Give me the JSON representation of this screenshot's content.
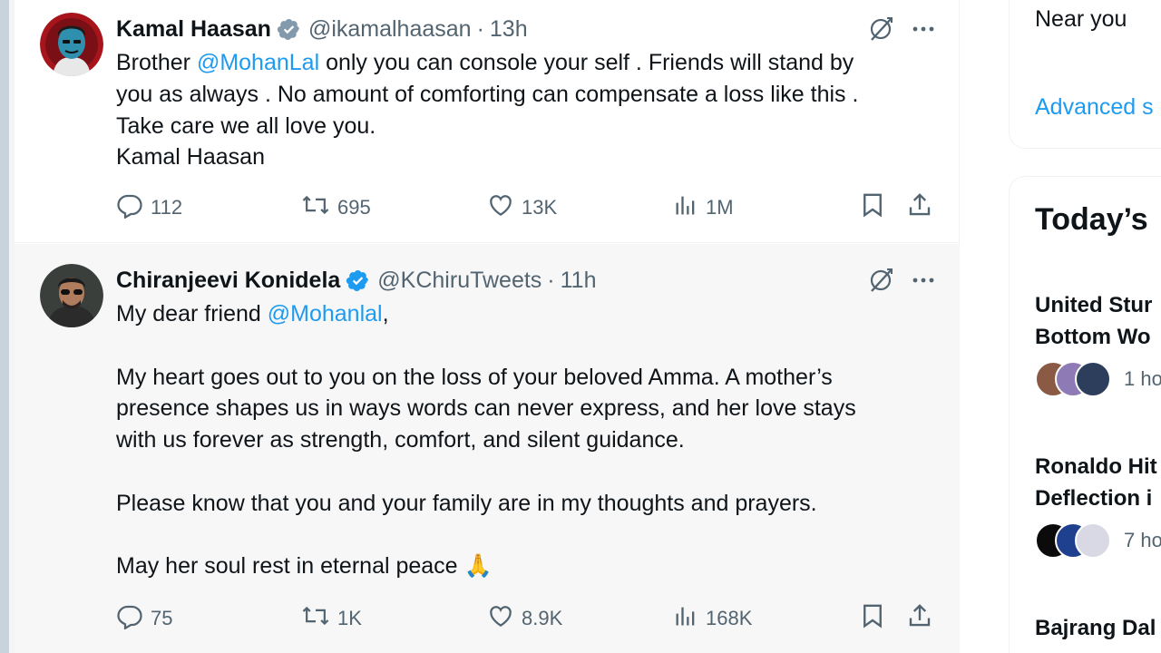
{
  "tweets": [
    {
      "name": "Kamal Haasan",
      "handle": "@ikamalhaasan",
      "separator": "·",
      "time": "13h",
      "paragraphs": [
        {
          "before": "Brother ",
          "mention": "@MohanLal",
          "after": " only you can console your self . Friends will stand by"
        },
        {
          "before": "you as always . No amount of comforting can compensate a loss like this .",
          "mention": "",
          "after": ""
        },
        {
          "before": "Take care we all love you.",
          "mention": "",
          "after": ""
        },
        {
          "before": "Kamal Haasan",
          "mention": "",
          "after": ""
        }
      ],
      "stats": {
        "replies": "112",
        "reposts": "695",
        "likes": "13K",
        "views": "1M"
      }
    },
    {
      "name": "Chiranjeevi Konidela",
      "handle": "@KChiruTweets",
      "separator": "·",
      "time": "11h",
      "paragraphs": [
        {
          "before": "My dear friend ",
          "mention": "@Mohanlal",
          "after": ","
        },
        {
          "before": "",
          "mention": "",
          "after": ""
        },
        {
          "before": "My heart goes out to you on the loss of your beloved Amma. A mother’s",
          "mention": "",
          "after": ""
        },
        {
          "before": "presence shapes us in ways words can never express, and her love stays",
          "mention": "",
          "after": ""
        },
        {
          "before": "with us forever as strength, comfort, and silent guidance.",
          "mention": "",
          "after": ""
        },
        {
          "before": "",
          "mention": "",
          "after": ""
        },
        {
          "before": "Please know that you and your family are in my thoughts and prayers.",
          "mention": "",
          "after": ""
        },
        {
          "before": "",
          "mention": "",
          "after": ""
        },
        {
          "before": "May her soul rest in eternal peace ",
          "mention": "",
          "after": "🙏"
        }
      ],
      "stats": {
        "replies": "75",
        "reposts": "1K",
        "likes": "8.9K",
        "views": "168K"
      }
    }
  ],
  "sidebar": {
    "location_label": "Near you",
    "advanced_search_label": "Advanced s",
    "trends_title": "Today’s",
    "trends": [
      {
        "title_line1": "United Stur",
        "title_line2": "Bottom Wo",
        "time": "1 ho"
      },
      {
        "title_line1": "Ronaldo Hit",
        "title_line2": "Deflection i",
        "time": "7 ho"
      },
      {
        "title_line1": "Bajrang Dal",
        "title_line2": "",
        "time": ""
      }
    ]
  },
  "colors": {
    "accent": "#1d9bf0",
    "text": "#0f1419",
    "muted": "#536471",
    "hover_bg": "#f7f7f7",
    "border": "#eff3f4"
  },
  "icons": {
    "verified": "verified-badge-icon",
    "grok": "grok-icon",
    "more": "more-icon",
    "reply": "reply-icon",
    "repost": "repost-icon",
    "like": "like-icon",
    "views": "views-icon",
    "bookmark": "bookmark-icon",
    "share": "share-icon"
  }
}
